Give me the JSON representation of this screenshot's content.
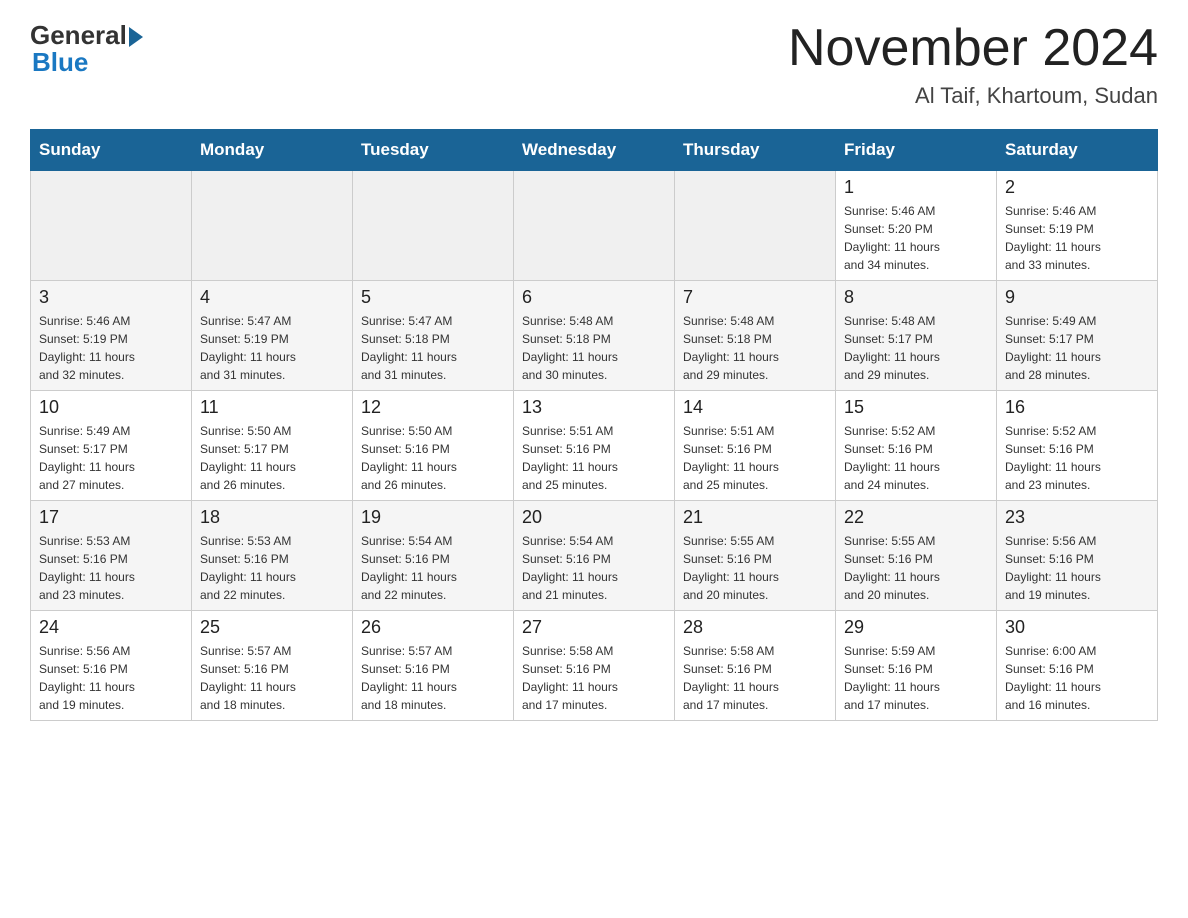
{
  "logo": {
    "general": "General",
    "blue": "Blue"
  },
  "title": "November 2024",
  "subtitle": "Al Taif, Khartoum, Sudan",
  "days_of_week": [
    "Sunday",
    "Monday",
    "Tuesday",
    "Wednesday",
    "Thursday",
    "Friday",
    "Saturday"
  ],
  "weeks": [
    [
      {
        "day": "",
        "info": ""
      },
      {
        "day": "",
        "info": ""
      },
      {
        "day": "",
        "info": ""
      },
      {
        "day": "",
        "info": ""
      },
      {
        "day": "",
        "info": ""
      },
      {
        "day": "1",
        "info": "Sunrise: 5:46 AM\nSunset: 5:20 PM\nDaylight: 11 hours\nand 34 minutes."
      },
      {
        "day": "2",
        "info": "Sunrise: 5:46 AM\nSunset: 5:19 PM\nDaylight: 11 hours\nand 33 minutes."
      }
    ],
    [
      {
        "day": "3",
        "info": "Sunrise: 5:46 AM\nSunset: 5:19 PM\nDaylight: 11 hours\nand 32 minutes."
      },
      {
        "day": "4",
        "info": "Sunrise: 5:47 AM\nSunset: 5:19 PM\nDaylight: 11 hours\nand 31 minutes."
      },
      {
        "day": "5",
        "info": "Sunrise: 5:47 AM\nSunset: 5:18 PM\nDaylight: 11 hours\nand 31 minutes."
      },
      {
        "day": "6",
        "info": "Sunrise: 5:48 AM\nSunset: 5:18 PM\nDaylight: 11 hours\nand 30 minutes."
      },
      {
        "day": "7",
        "info": "Sunrise: 5:48 AM\nSunset: 5:18 PM\nDaylight: 11 hours\nand 29 minutes."
      },
      {
        "day": "8",
        "info": "Sunrise: 5:48 AM\nSunset: 5:17 PM\nDaylight: 11 hours\nand 29 minutes."
      },
      {
        "day": "9",
        "info": "Sunrise: 5:49 AM\nSunset: 5:17 PM\nDaylight: 11 hours\nand 28 minutes."
      }
    ],
    [
      {
        "day": "10",
        "info": "Sunrise: 5:49 AM\nSunset: 5:17 PM\nDaylight: 11 hours\nand 27 minutes."
      },
      {
        "day": "11",
        "info": "Sunrise: 5:50 AM\nSunset: 5:17 PM\nDaylight: 11 hours\nand 26 minutes."
      },
      {
        "day": "12",
        "info": "Sunrise: 5:50 AM\nSunset: 5:16 PM\nDaylight: 11 hours\nand 26 minutes."
      },
      {
        "day": "13",
        "info": "Sunrise: 5:51 AM\nSunset: 5:16 PM\nDaylight: 11 hours\nand 25 minutes."
      },
      {
        "day": "14",
        "info": "Sunrise: 5:51 AM\nSunset: 5:16 PM\nDaylight: 11 hours\nand 25 minutes."
      },
      {
        "day": "15",
        "info": "Sunrise: 5:52 AM\nSunset: 5:16 PM\nDaylight: 11 hours\nand 24 minutes."
      },
      {
        "day": "16",
        "info": "Sunrise: 5:52 AM\nSunset: 5:16 PM\nDaylight: 11 hours\nand 23 minutes."
      }
    ],
    [
      {
        "day": "17",
        "info": "Sunrise: 5:53 AM\nSunset: 5:16 PM\nDaylight: 11 hours\nand 23 minutes."
      },
      {
        "day": "18",
        "info": "Sunrise: 5:53 AM\nSunset: 5:16 PM\nDaylight: 11 hours\nand 22 minutes."
      },
      {
        "day": "19",
        "info": "Sunrise: 5:54 AM\nSunset: 5:16 PM\nDaylight: 11 hours\nand 22 minutes."
      },
      {
        "day": "20",
        "info": "Sunrise: 5:54 AM\nSunset: 5:16 PM\nDaylight: 11 hours\nand 21 minutes."
      },
      {
        "day": "21",
        "info": "Sunrise: 5:55 AM\nSunset: 5:16 PM\nDaylight: 11 hours\nand 20 minutes."
      },
      {
        "day": "22",
        "info": "Sunrise: 5:55 AM\nSunset: 5:16 PM\nDaylight: 11 hours\nand 20 minutes."
      },
      {
        "day": "23",
        "info": "Sunrise: 5:56 AM\nSunset: 5:16 PM\nDaylight: 11 hours\nand 19 minutes."
      }
    ],
    [
      {
        "day": "24",
        "info": "Sunrise: 5:56 AM\nSunset: 5:16 PM\nDaylight: 11 hours\nand 19 minutes."
      },
      {
        "day": "25",
        "info": "Sunrise: 5:57 AM\nSunset: 5:16 PM\nDaylight: 11 hours\nand 18 minutes."
      },
      {
        "day": "26",
        "info": "Sunrise: 5:57 AM\nSunset: 5:16 PM\nDaylight: 11 hours\nand 18 minutes."
      },
      {
        "day": "27",
        "info": "Sunrise: 5:58 AM\nSunset: 5:16 PM\nDaylight: 11 hours\nand 17 minutes."
      },
      {
        "day": "28",
        "info": "Sunrise: 5:58 AM\nSunset: 5:16 PM\nDaylight: 11 hours\nand 17 minutes."
      },
      {
        "day": "29",
        "info": "Sunrise: 5:59 AM\nSunset: 5:16 PM\nDaylight: 11 hours\nand 17 minutes."
      },
      {
        "day": "30",
        "info": "Sunrise: 6:00 AM\nSunset: 5:16 PM\nDaylight: 11 hours\nand 16 minutes."
      }
    ]
  ]
}
